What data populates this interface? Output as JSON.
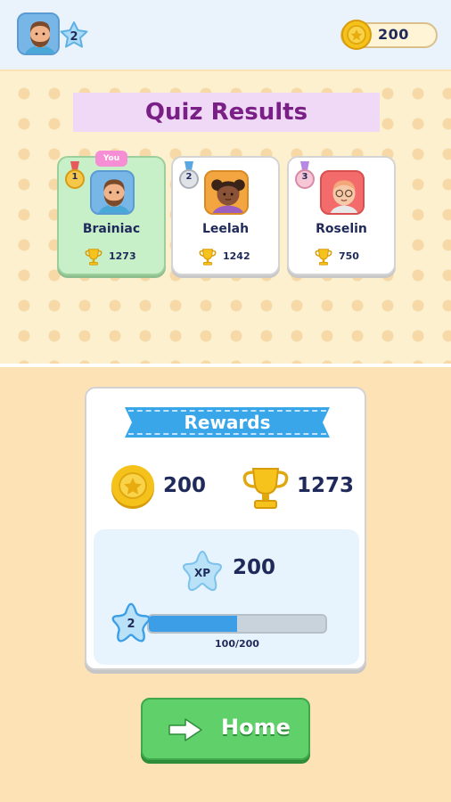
{
  "header": {
    "level": "2",
    "coins": "200"
  },
  "results": {
    "title": "Quiz Results",
    "you_tag": "You",
    "players": [
      {
        "rank": "1",
        "name": "Brainiac",
        "score": "1273"
      },
      {
        "rank": "2",
        "name": "Leelah",
        "score": "1242"
      },
      {
        "rank": "3",
        "name": "Roselin",
        "score": "750"
      }
    ]
  },
  "rewards": {
    "title": "Rewards",
    "coins": "200",
    "trophies": "1273",
    "xp_label": "XP",
    "xp": "200",
    "level": "2",
    "progress_text": "100/200",
    "progress_fraction": 0.5
  },
  "home": {
    "label": "Home"
  },
  "colors": {
    "accent_blue": "#39a6ea",
    "title_purple": "#7a1f86",
    "button_green": "#5fd06a",
    "you_card": "#c8f0c8"
  },
  "icons": [
    "avatar",
    "star-badge",
    "coin-icon",
    "medal-icon",
    "trophy-icon",
    "xp-star-icon",
    "arrow-right-icon"
  ]
}
